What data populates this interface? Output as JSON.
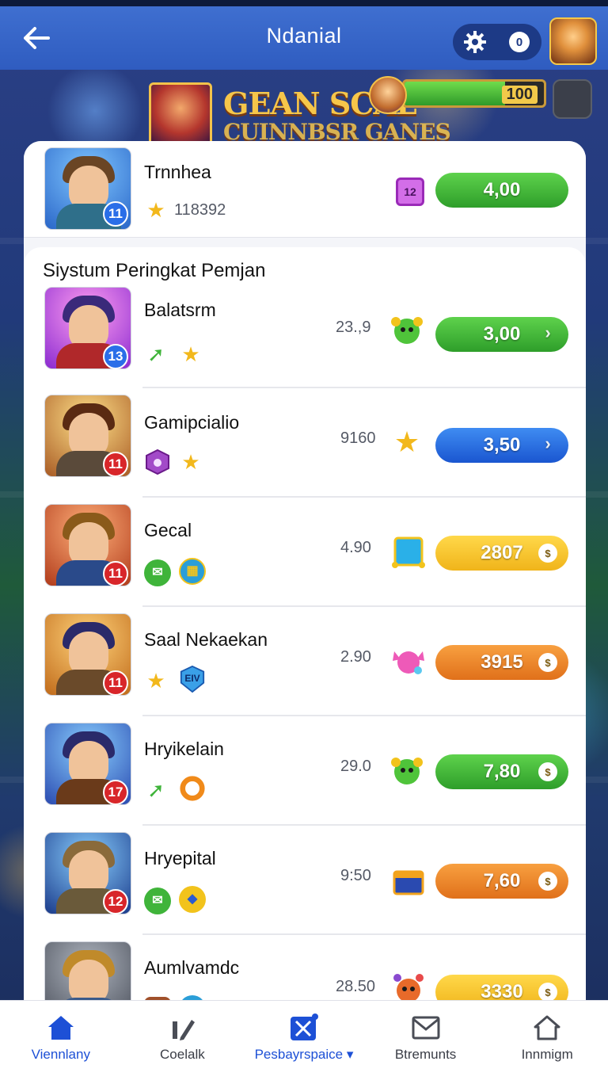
{
  "header": {
    "title": "Ndanial",
    "coin_label": "0"
  },
  "banner": {
    "title": "GEAN SCAL",
    "subtitle": "CUINNBSR GANES",
    "progress_text": "100",
    "progress_fraction": 0.72
  },
  "top_item": {
    "name": "Trnnhea",
    "points": "118392",
    "badge_text": "12",
    "button_label": "4,00"
  },
  "section": {
    "title": "Siystum Peringkat Pemjan"
  },
  "players": [
    {
      "name": "Balatsrm",
      "score": "23.,9",
      "level": "13",
      "button": "3,00"
    },
    {
      "name": "Gamipcialio",
      "score": "9160",
      "level": "11",
      "button": "3,50"
    },
    {
      "name": "Gecal",
      "score": "4.90",
      "level": "11",
      "button": "2807"
    },
    {
      "name": "Saal Nekaekan",
      "score": "2.90",
      "level": "11",
      "button": "3915"
    },
    {
      "name": "Hryikelain",
      "score": "29.0",
      "level": "17",
      "button": "7,80"
    },
    {
      "name": "Hryepital",
      "score": "9:50",
      "level": "12",
      "button": "7,60"
    },
    {
      "name": "Aumlvamdc",
      "score": "28.50",
      "level": "",
      "button": "3330"
    }
  ],
  "tags": {
    "gecal_box": "",
    "saal_shield": "EIV"
  },
  "colors": {
    "header": "#3f6fd0",
    "green": "#3fb43a",
    "blue": "#2a6ee8",
    "yellow": "#f2c31c",
    "orange": "#ee8a2a",
    "level_blue": "#2a6ee8",
    "level_red": "#d8262a"
  },
  "nav": [
    {
      "label": "Viennlany",
      "icon": "home-icon"
    },
    {
      "label": "Coelalk",
      "icon": "pencil-icon"
    },
    {
      "label": "Pesbayrspaice",
      "icon": "crossed-tools-icon"
    },
    {
      "label": "Btremunts",
      "icon": "mail-icon"
    },
    {
      "label": "Innmigm",
      "icon": "house-outline-icon"
    }
  ]
}
